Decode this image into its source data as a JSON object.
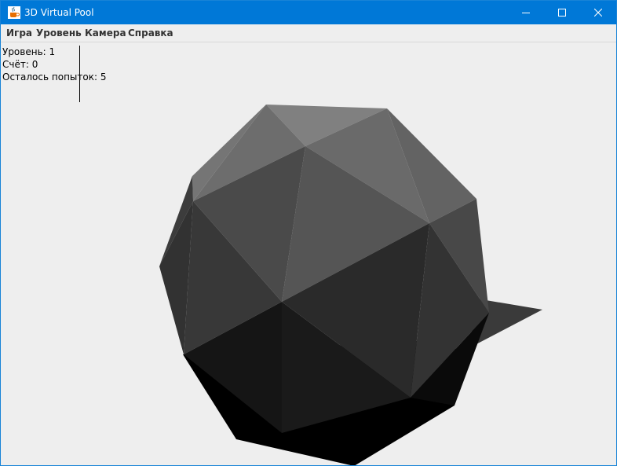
{
  "window": {
    "title": "3D Virtual Pool",
    "icon": "java-coffee-cup-icon",
    "controls": [
      "minimize-icon",
      "maximize-icon",
      "close-icon"
    ]
  },
  "menu": {
    "items": [
      {
        "label": "Игра"
      },
      {
        "label": "Уровень"
      },
      {
        "label": "Камера"
      },
      {
        "label": "Справка"
      }
    ]
  },
  "hud": {
    "level": "Уровень: 1",
    "score": "Счёт: 0",
    "attempts": "Осталось попыток: 5"
  },
  "colors": {
    "titlebar": "#0078d7",
    "background": "#eeeeee",
    "shadow": "#000000"
  }
}
